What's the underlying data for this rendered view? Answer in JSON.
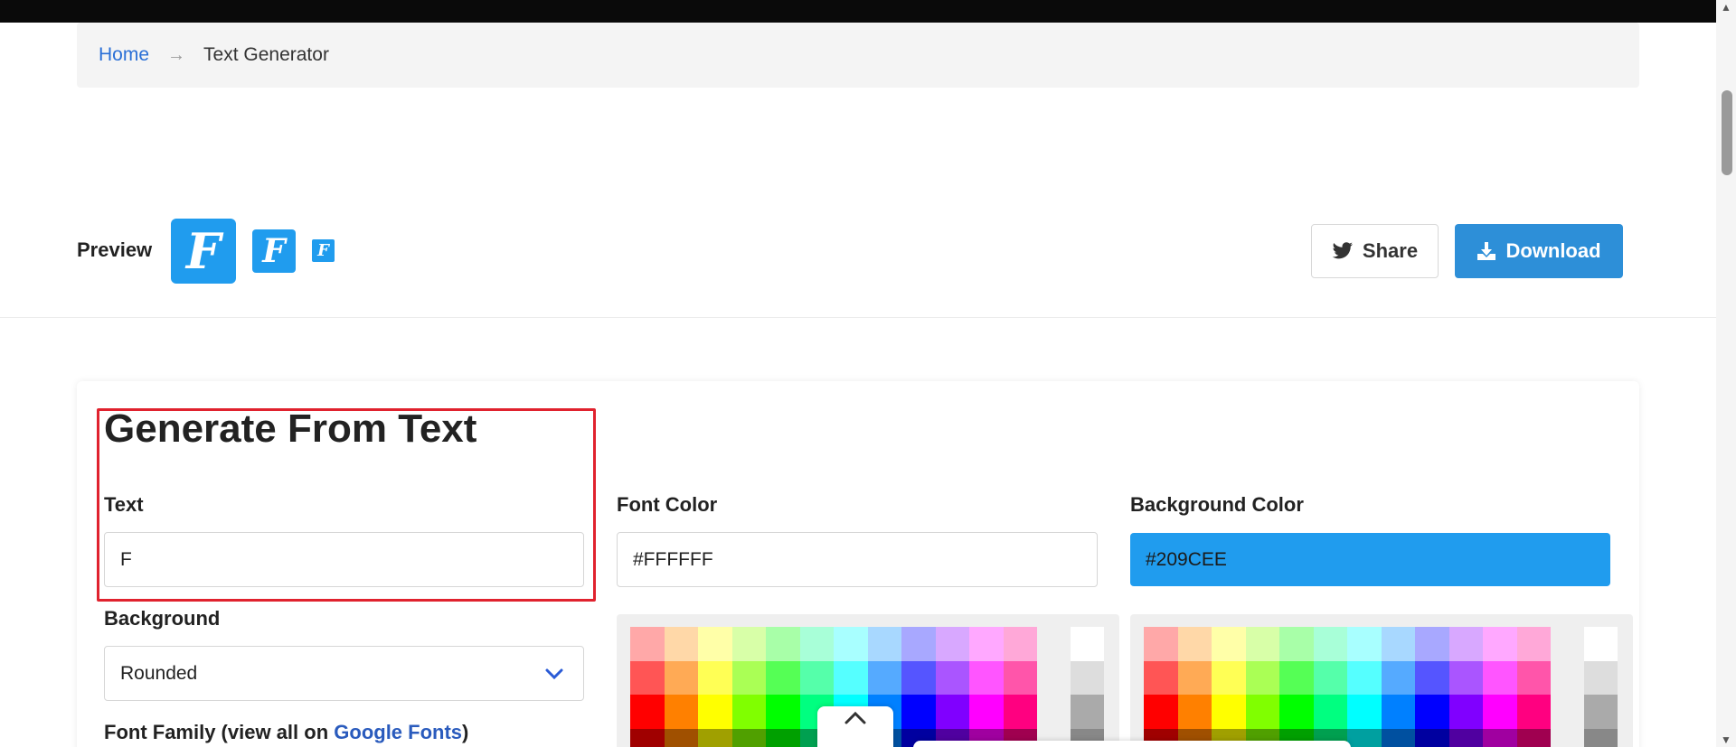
{
  "breadcrumb": {
    "home": "Home",
    "separator": "→",
    "current": "Text Generator"
  },
  "preview": {
    "label": "Preview",
    "letter": "F",
    "bg_color": "#209CEE",
    "fg_color": "#FFFFFF"
  },
  "actions": {
    "share_label": "Share",
    "download_label": "Download",
    "share_icon": "twitter-icon",
    "download_icon": "download-icon"
  },
  "form": {
    "title": "Generate From Text",
    "text_label": "Text",
    "text_value": "F",
    "font_color_label": "Font Color",
    "font_color_value": "#FFFFFF",
    "bg_color_label": "Background Color",
    "bg_color_value": "#209CEE",
    "background_label": "Background",
    "background_value": "Rounded",
    "font_family_label_prefix": "Font Family (view all on ",
    "font_family_link": "Google Fonts",
    "font_family_label_suffix": ")"
  },
  "palette": {
    "hues": [
      [
        "#ffa8a8",
        "#ffd8a8",
        "#ffffa8",
        "#d8ffa8",
        "#a8ffa8",
        "#a8ffd8",
        "#a8ffff",
        "#a8d8ff",
        "#a8a8ff",
        "#d8a8ff",
        "#ffa8ff",
        "#ffa8d8"
      ],
      [
        "#ff5555",
        "#ffaa55",
        "#ffff55",
        "#aaff55",
        "#55ff55",
        "#55ffaa",
        "#55ffff",
        "#55aaff",
        "#5555ff",
        "#aa55ff",
        "#ff55ff",
        "#ff55aa"
      ],
      [
        "#ff0000",
        "#ff8000",
        "#ffff00",
        "#80ff00",
        "#00ff00",
        "#00ff80",
        "#00ffff",
        "#0080ff",
        "#0000ff",
        "#8000ff",
        "#ff00ff",
        "#ff0080"
      ],
      [
        "#a00000",
        "#a05000",
        "#a0a000",
        "#50a000",
        "#00a000",
        "#00a050",
        "#00a0a0",
        "#0050a0",
        "#0000a0",
        "#5000a0",
        "#a000a0",
        "#a00050"
      ]
    ],
    "grays": [
      "#ffffff",
      "#dddddd",
      "#aaaaaa",
      "#888888"
    ]
  }
}
